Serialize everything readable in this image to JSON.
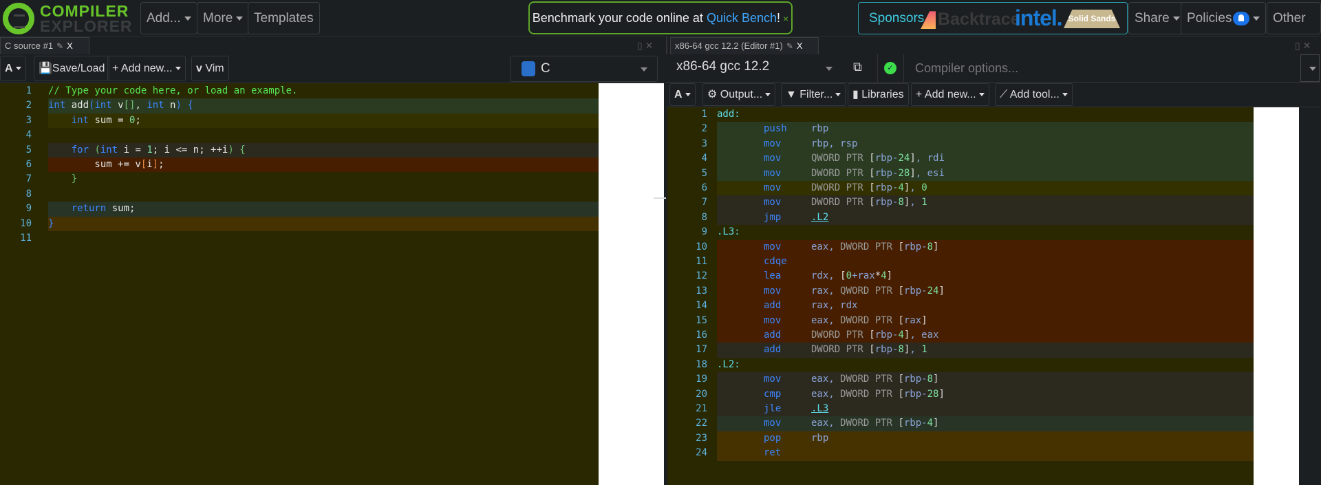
{
  "nav": {
    "logo_top": "COMPILER",
    "logo_bottom": "EXPLORER",
    "add": "Add...",
    "more": "More",
    "templates": "Templates",
    "bench_text": "Benchmark your code online at ",
    "bench_link": "Quick Bench",
    "bench_excl": "!",
    "bench_close": "×",
    "sponsors": "Sponsors",
    "sponsor_logos": [
      "Backtrace",
      "intel.",
      "Solid Sands"
    ],
    "share": "Share",
    "policies": "Policies",
    "other": "Other"
  },
  "source": {
    "tab": "C source #1",
    "tab_close": "X",
    "font_btn": "A",
    "save_load": "Save/Load",
    "add_new": "Add new...",
    "vim": "Vim",
    "language": "C",
    "lines": [
      {
        "bg": "#292800",
        "tokens": [
          [
            "// Type your code here, or load an example.",
            "cm"
          ]
        ]
      },
      {
        "bg": "#2a3b22",
        "tokens": [
          [
            "int",
            "kw"
          ],
          [
            " add",
            "id"
          ],
          [
            "(",
            "kw"
          ],
          [
            "int",
            "kw"
          ],
          [
            " v",
            "id"
          ],
          [
            "[]",
            "br"
          ],
          [
            ", ",
            "pun"
          ],
          [
            "int",
            "kw"
          ],
          [
            " n",
            "id"
          ],
          [
            ")",
            "kw"
          ],
          [
            " {",
            "kw"
          ]
        ]
      },
      {
        "bg": "#333100",
        "tokens": [
          [
            "    ",
            "id"
          ],
          [
            "int",
            "kw"
          ],
          [
            " sum = ",
            "id"
          ],
          [
            "0",
            "num"
          ],
          [
            ";",
            "pun"
          ]
        ]
      },
      {
        "bg": "#292800",
        "tokens": []
      },
      {
        "bg": "#2c2a1f",
        "tokens": [
          [
            "    ",
            "id"
          ],
          [
            "for",
            "kw"
          ],
          [
            " (",
            "br"
          ],
          [
            "int",
            "kw"
          ],
          [
            " i = ",
            "id"
          ],
          [
            "1",
            "num"
          ],
          [
            "; i <= n; ++i",
            "id"
          ],
          [
            ")",
            "br"
          ],
          [
            " {",
            "br"
          ]
        ]
      },
      {
        "bg": "#471f00",
        "tokens": [
          [
            "        sum += v",
            "id"
          ],
          [
            "[",
            "bro"
          ],
          [
            "i",
            "id"
          ],
          [
            "]",
            "bro"
          ],
          [
            ";",
            "pun"
          ]
        ]
      },
      {
        "bg": "#292800",
        "tokens": [
          [
            "    ",
            "id"
          ],
          [
            "}",
            "br"
          ]
        ]
      },
      {
        "bg": "#292800",
        "tokens": []
      },
      {
        "bg": "#283426",
        "tokens": [
          [
            "    ",
            "id"
          ],
          [
            "return",
            "kw"
          ],
          [
            " sum;",
            "id"
          ]
        ]
      },
      {
        "bg": "#463200",
        "tokens": [
          [
            "}",
            "kw"
          ]
        ]
      },
      {
        "bg": "#292800",
        "tokens": []
      }
    ]
  },
  "compiler": {
    "tab": "x86-64 gcc 12.2 (Editor #1)",
    "tab_close": "X",
    "name": "x86-64 gcc 12.2",
    "options_placeholder": "Compiler options...",
    "status": "ok",
    "font_btn": "A",
    "output": "Output...",
    "filter": "Filter...",
    "libraries": "Libraries",
    "add_new": "Add new...",
    "add_tool": "Add tool...",
    "lines": [
      {
        "bg": "#292800",
        "tokens": [
          [
            "add:",
            "lbl"
          ]
        ]
      },
      {
        "bg": "#2a3b22",
        "tokens": [
          [
            "push",
            "kw"
          ],
          [
            "rbp",
            "ao"
          ]
        ]
      },
      {
        "bg": "#2a3b22",
        "tokens": [
          [
            "mov",
            "kw"
          ],
          [
            "rbp, rsp",
            "ao"
          ]
        ]
      },
      {
        "bg": "#2a3b22",
        "tokens": [
          [
            "mov",
            "kw"
          ],
          [
            "QWORD PTR ",
            "ptr"
          ],
          [
            "[",
            "sq"
          ],
          [
            "rbp-",
            "ao"
          ],
          [
            "24",
            "num"
          ],
          [
            "]",
            "sq"
          ],
          [
            ", rdi",
            "ao"
          ]
        ]
      },
      {
        "bg": "#2a3b22",
        "tokens": [
          [
            "mov",
            "kw"
          ],
          [
            "DWORD PTR ",
            "ptr"
          ],
          [
            "[",
            "sq"
          ],
          [
            "rbp-",
            "ao"
          ],
          [
            "28",
            "num"
          ],
          [
            "]",
            "sq"
          ],
          [
            ", esi",
            "ao"
          ]
        ]
      },
      {
        "bg": "#333100",
        "tokens": [
          [
            "mov",
            "kw"
          ],
          [
            "DWORD PTR ",
            "ptr"
          ],
          [
            "[",
            "sq"
          ],
          [
            "rbp-",
            "ao"
          ],
          [
            "4",
            "num"
          ],
          [
            "]",
            "sq"
          ],
          [
            ", ",
            "ao"
          ],
          [
            "0",
            "num"
          ]
        ]
      },
      {
        "bg": "#2c2a1f",
        "tokens": [
          [
            "mov",
            "kw"
          ],
          [
            "DWORD PTR ",
            "ptr"
          ],
          [
            "[",
            "sq"
          ],
          [
            "rbp-",
            "ao"
          ],
          [
            "8",
            "num"
          ],
          [
            "]",
            "sq"
          ],
          [
            ", ",
            "ao"
          ],
          [
            "1",
            "num"
          ]
        ]
      },
      {
        "bg": "#2c2a1f",
        "tokens": [
          [
            "jmp",
            "kw"
          ],
          [
            ".L2",
            "lnk"
          ]
        ]
      },
      {
        "bg": "#292800",
        "tokens": [
          [
            ".L3:",
            "lbl"
          ]
        ]
      },
      {
        "bg": "#471f00",
        "tokens": [
          [
            "mov",
            "kw"
          ],
          [
            "eax, ",
            "ao"
          ],
          [
            "DWORD PTR ",
            "ptr"
          ],
          [
            "[",
            "sq"
          ],
          [
            "rbp-",
            "ao"
          ],
          [
            "8",
            "num"
          ],
          [
            "]",
            "sq"
          ]
        ]
      },
      {
        "bg": "#471f00",
        "tokens": [
          [
            "cdqe",
            "kw"
          ]
        ]
      },
      {
        "bg": "#471f00",
        "tokens": [
          [
            "lea",
            "kw"
          ],
          [
            "rdx, ",
            "ao"
          ],
          [
            "[",
            "sq"
          ],
          [
            "0",
            "num"
          ],
          [
            "+rax",
            "ao"
          ],
          [
            "*",
            "sq"
          ],
          [
            "4",
            "num"
          ],
          [
            "]",
            "sq"
          ]
        ]
      },
      {
        "bg": "#471f00",
        "tokens": [
          [
            "mov",
            "kw"
          ],
          [
            "rax, ",
            "ao"
          ],
          [
            "QWORD PTR ",
            "ptr"
          ],
          [
            "[",
            "sq"
          ],
          [
            "rbp-",
            "ao"
          ],
          [
            "24",
            "num"
          ],
          [
            "]",
            "sq"
          ]
        ]
      },
      {
        "bg": "#471f00",
        "tokens": [
          [
            "add",
            "kw"
          ],
          [
            "rax, rdx",
            "ao"
          ]
        ]
      },
      {
        "bg": "#471f00",
        "tokens": [
          [
            "mov",
            "kw"
          ],
          [
            "eax, ",
            "ao"
          ],
          [
            "DWORD PTR ",
            "ptr"
          ],
          [
            "[",
            "sq"
          ],
          [
            "rax",
            "ao"
          ],
          [
            "]",
            "sq"
          ]
        ]
      },
      {
        "bg": "#471f00",
        "tokens": [
          [
            "add",
            "kw"
          ],
          [
            "DWORD PTR ",
            "ptr"
          ],
          [
            "[",
            "sq"
          ],
          [
            "rbp-",
            "ao"
          ],
          [
            "4",
            "num"
          ],
          [
            "]",
            "sq"
          ],
          [
            ", eax",
            "ao"
          ]
        ]
      },
      {
        "bg": "#2c2a1f",
        "tokens": [
          [
            "add",
            "kw"
          ],
          [
            "DWORD PTR ",
            "ptr"
          ],
          [
            "[",
            "sq"
          ],
          [
            "rbp-",
            "ao"
          ],
          [
            "8",
            "num"
          ],
          [
            "]",
            "sq"
          ],
          [
            ", ",
            "ao"
          ],
          [
            "1",
            "num"
          ]
        ]
      },
      {
        "bg": "#292800",
        "tokens": [
          [
            ".L2:",
            "lbl"
          ]
        ]
      },
      {
        "bg": "#2c2a1f",
        "tokens": [
          [
            "mov",
            "kw"
          ],
          [
            "eax, ",
            "ao"
          ],
          [
            "DWORD PTR ",
            "ptr"
          ],
          [
            "[",
            "sq"
          ],
          [
            "rbp-",
            "ao"
          ],
          [
            "8",
            "num"
          ],
          [
            "]",
            "sq"
          ]
        ]
      },
      {
        "bg": "#2c2a1f",
        "tokens": [
          [
            "cmp",
            "kw"
          ],
          [
            "eax, ",
            "ao"
          ],
          [
            "DWORD PTR ",
            "ptr"
          ],
          [
            "[",
            "sq"
          ],
          [
            "rbp-",
            "ao"
          ],
          [
            "28",
            "num"
          ],
          [
            "]",
            "sq"
          ]
        ]
      },
      {
        "bg": "#2c2a1f",
        "tokens": [
          [
            "jle",
            "kw"
          ],
          [
            ".L3",
            "lnk"
          ]
        ]
      },
      {
        "bg": "#283426",
        "tokens": [
          [
            "mov",
            "kw"
          ],
          [
            "eax, ",
            "ao"
          ],
          [
            "DWORD PTR ",
            "ptr"
          ],
          [
            "[",
            "sq"
          ],
          [
            "rbp-",
            "ao"
          ],
          [
            "4",
            "num"
          ],
          [
            "]",
            "sq"
          ]
        ]
      },
      {
        "bg": "#463200",
        "tokens": [
          [
            "pop",
            "kw"
          ],
          [
            "rbp",
            "ao"
          ]
        ]
      },
      {
        "bg": "#463200",
        "tokens": [
          [
            "ret",
            "kw"
          ]
        ]
      }
    ]
  }
}
